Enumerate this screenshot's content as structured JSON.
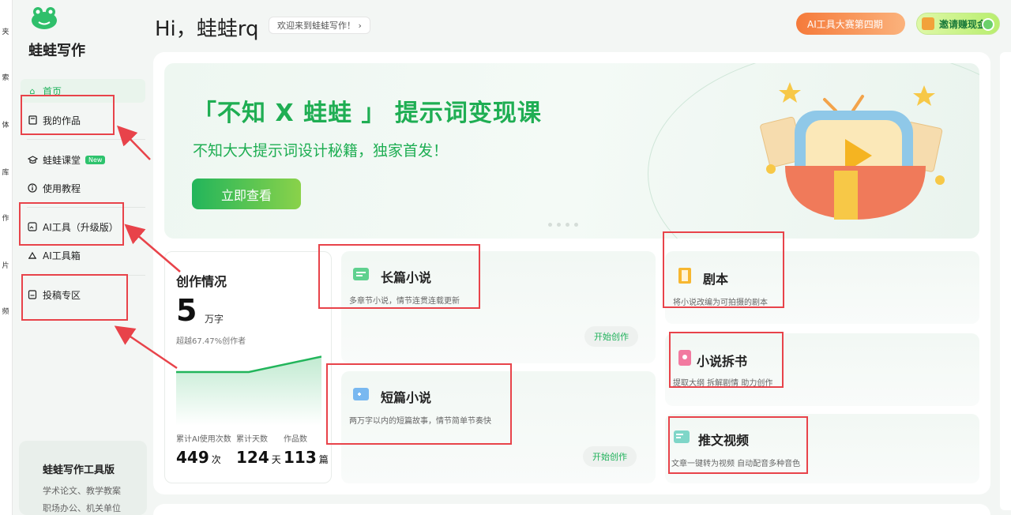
{
  "strip": {
    "glyphs": [
      "夹",
      "索",
      "体",
      "库",
      "作",
      "片",
      "频"
    ]
  },
  "sidebar": {
    "brand": "蛙蛙写作",
    "items": [
      {
        "label": "首页",
        "icon": "home-icon"
      },
      {
        "label": "我的作品",
        "icon": "book-icon"
      },
      {
        "label": "蛙蛙课堂",
        "icon": "graduation-cap-icon",
        "badge": "New"
      },
      {
        "label": "使用教程",
        "icon": "info-icon"
      },
      {
        "label": "AI工具（升级版）",
        "icon": "image-edit-icon"
      },
      {
        "label": "AI工具箱",
        "icon": "toolbox-icon"
      },
      {
        "label": "投稿专区",
        "icon": "submit-icon"
      }
    ],
    "promo": {
      "title": "蛙蛙写作工具版",
      "lines": [
        "学术论文、教学教案",
        "职场办公、机关单位"
      ]
    }
  },
  "header": {
    "greeting": "Hi，蛙蛙rq",
    "welcome": "欢迎来到蛙蛙写作！ ›",
    "contest": "AI工具大赛第四期",
    "invite": "邀请赚现金"
  },
  "banner": {
    "title": "「不知 X 蛙蛙 」 提示词变现课",
    "subtitle": "不知大大提示词设计秘籍，独家首发！",
    "button": "立即查看"
  },
  "stats": {
    "title": "创作情况",
    "big_value": "5",
    "big_unit": "万字",
    "percent_text": "超越67.47%创作者",
    "chart_data": {
      "type": "line",
      "x": [
        0,
        1,
        2
      ],
      "y": [
        0.0,
        0.0,
        0.61
      ],
      "area": true,
      "color": "#22b55b"
    },
    "metrics": [
      {
        "label": "累计AI使用次数",
        "value": "449",
        "unit": "次"
      },
      {
        "label": "累计天数",
        "value": "124",
        "unit": "天"
      },
      {
        "label": "作品数",
        "value": "113",
        "unit": "篇"
      }
    ]
  },
  "cards": {
    "long_novel": {
      "title": "长篇小说",
      "desc": "多章节小说，情节连贯连载更新",
      "button": "开始创作"
    },
    "short_novel": {
      "title": "短篇小说",
      "desc": "两万字以内的短篇故事，情节简单节奏快",
      "button": "开始创作"
    },
    "script": {
      "title": "剧本",
      "desc": "将小说改编为可拍摄的剧本"
    },
    "breakdown": {
      "title": "小说拆书",
      "desc": "提取大纲 拆解剧情 助力创作"
    },
    "video": {
      "title": "推文视频",
      "desc": "文章一键转为视频 自动配音多种音色"
    }
  },
  "colors": {
    "accent": "#22b55b",
    "highlight": "#e8434a",
    "contest": "#f57a3a"
  }
}
